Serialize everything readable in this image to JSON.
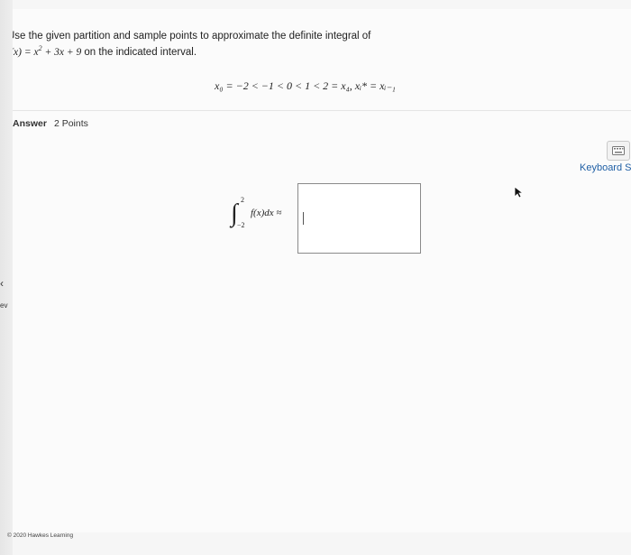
{
  "question": {
    "line1": "Use the given partition and sample points to approximate the definite integral of",
    "fx_prefix": "f(x) = x",
    "fx_exp": "2",
    "fx_suffix": " + 3x + 9",
    "line2_tail": " on the indicated interval."
  },
  "partition": {
    "text": "x₀ = −2 < −1 < 0 < 1 < 2 = x₄, xᵢ* = xᵢ₋₁"
  },
  "answer": {
    "label": "Answer",
    "points": "2 Points"
  },
  "integral": {
    "lower": "−2",
    "upper": "2",
    "expression": "f(x)dx ≈"
  },
  "input": {
    "value": ""
  },
  "toolbar": {
    "keyboard_label": "Keyboard S",
    "keyboard_icon": "keyboard-icon"
  },
  "nav": {
    "prev_label": "ev",
    "prev_icon": "chevron-left-icon"
  },
  "footer": {
    "copyright": "© 2020 Hawkes Learning"
  }
}
